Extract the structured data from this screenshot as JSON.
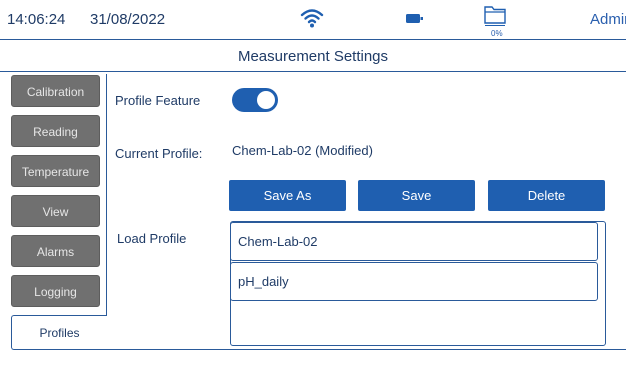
{
  "status_bar": {
    "time": "14:06:24",
    "date": "31/08/2022",
    "storage_percent": "0%",
    "user": "Admin",
    "icons": [
      "wifi-icon",
      "battery-icon",
      "folder-icon"
    ]
  },
  "header": {
    "title": "Measurement Settings"
  },
  "sidebar": {
    "tabs": [
      {
        "label": "Calibration",
        "active": false
      },
      {
        "label": "Reading",
        "active": false
      },
      {
        "label": "Temperature",
        "active": false
      },
      {
        "label": "View",
        "active": false
      },
      {
        "label": "Alarms",
        "active": false
      },
      {
        "label": "Logging",
        "active": false
      },
      {
        "label": "Profiles",
        "active": true
      }
    ]
  },
  "profiles": {
    "feature_label": "Profile Feature",
    "feature_enabled": true,
    "current_label": "Current Profile:",
    "current_value": "Chem-Lab-02 (Modified)",
    "buttons": {
      "save_as": "Save As",
      "save": "Save",
      "delete": "Delete"
    },
    "load_label": "Load Profile",
    "list": [
      "Chem-Lab-02",
      "pH_daily"
    ]
  },
  "colors": {
    "accent": "#1f5fb0",
    "tab_inactive": "#707070",
    "text": "#1f3b66"
  }
}
